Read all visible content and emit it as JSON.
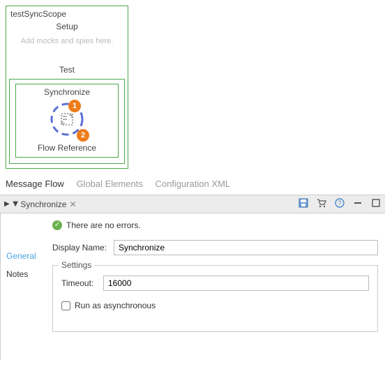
{
  "canvas": {
    "scope_name": "testSyncScope",
    "setup_label": "Setup",
    "setup_hint": "Add mocks and spies here.",
    "test_label": "Test",
    "sync_label": "Synchronize",
    "flowref_label": "Flow Reference",
    "badge1": "1",
    "badge2": "2"
  },
  "tabs": {
    "message_flow": "Message Flow",
    "global_elements": "Global Elements",
    "config_xml": "Configuration XML"
  },
  "properties": {
    "header_title": "Synchronize",
    "status_text": "There are no errors.",
    "side": {
      "general": "General",
      "notes": "Notes"
    },
    "display_name_label": "Display Name:",
    "display_name_value": "Synchronize",
    "settings_legend": "Settings",
    "timeout_label": "Timeout:",
    "timeout_value": "16000",
    "async_label": "Run as asynchronous"
  }
}
